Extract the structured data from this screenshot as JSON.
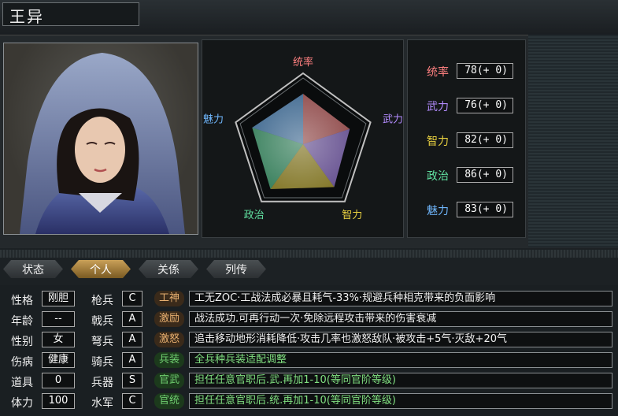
{
  "character": {
    "name": "王异"
  },
  "radar": {
    "labels": {
      "command": "统率",
      "war": "武力",
      "intelligence": "智力",
      "politics": "政治",
      "charm": "魅力"
    },
    "label_colors": {
      "command": "#ff8080",
      "war": "#b48cff",
      "intelligence": "#e8d040",
      "politics": "#60e0a0",
      "charm": "#70b8ff"
    },
    "values": {
      "command": 78,
      "war": 76,
      "intelligence": 82,
      "politics": 86,
      "charm": 83
    },
    "max": 100
  },
  "stats": [
    {
      "label": "统率",
      "value": "78(+ 0)",
      "color": "#ff8080"
    },
    {
      "label": "武力",
      "value": "76(+ 0)",
      "color": "#b48cff"
    },
    {
      "label": "智力",
      "value": "82(+ 0)",
      "color": "#e8d040"
    },
    {
      "label": "政治",
      "value": "86(+ 0)",
      "color": "#60e0a0"
    },
    {
      "label": "魅力",
      "value": "83(+ 0)",
      "color": "#70b8ff"
    }
  ],
  "tabs": [
    {
      "label": "状态",
      "active": false
    },
    {
      "label": "个人",
      "active": true
    },
    {
      "label": "关係",
      "active": false
    },
    {
      "label": "列传",
      "active": false
    }
  ],
  "personal": [
    {
      "label": "性格",
      "value": "刚胆"
    },
    {
      "label": "年龄",
      "value": "--"
    },
    {
      "label": "性别",
      "value": "女"
    },
    {
      "label": "伤病",
      "value": "健康"
    },
    {
      "label": "道具",
      "value": "0"
    },
    {
      "label": "体力",
      "value": "100"
    }
  ],
  "aptitude": [
    {
      "label": "枪兵",
      "value": "C"
    },
    {
      "label": "戟兵",
      "value": "A"
    },
    {
      "label": "弩兵",
      "value": "A"
    },
    {
      "label": "骑兵",
      "value": "A"
    },
    {
      "label": "兵器",
      "value": "S"
    },
    {
      "label": "水军",
      "value": "C"
    }
  ],
  "skills": [
    {
      "tag": "工神",
      "tag_color": "#e8b070",
      "tag_bg": "#3a2a1a",
      "text": "工无ZOC·工战法成必暴且耗气-33%·规避兵种相克带来的负面影响",
      "text_color": "#f0f0f0"
    },
    {
      "tag": "激励",
      "tag_color": "#e8b070",
      "tag_bg": "#3a2a1a",
      "text": "战法成功.可再行动一次·免除远程攻击带来的伤害衰减",
      "text_color": "#f0f0f0"
    },
    {
      "tag": "激怒",
      "tag_color": "#e8b070",
      "tag_bg": "#3a2a1a",
      "text": "追击移动地形消耗降低·攻击几率也激怒敌队·被攻击+5气·灭敌+20气",
      "text_color": "#f0f0f0"
    },
    {
      "tag": "兵装",
      "tag_color": "#70d070",
      "tag_bg": "#1c3a1c",
      "text": "全兵种兵装适配调整",
      "text_color": "#80e080"
    },
    {
      "tag": "官武",
      "tag_color": "#70d070",
      "tag_bg": "#1c3a1c",
      "text": "担任任意官职后.武.再加1-10(等同官阶等级)",
      "text_color": "#80e080"
    },
    {
      "tag": "官统",
      "tag_color": "#70d070",
      "tag_bg": "#1c3a1c",
      "text": "担任任意官职后.统.再加1-10(等同官阶等级)",
      "text_color": "#80e080"
    }
  ]
}
